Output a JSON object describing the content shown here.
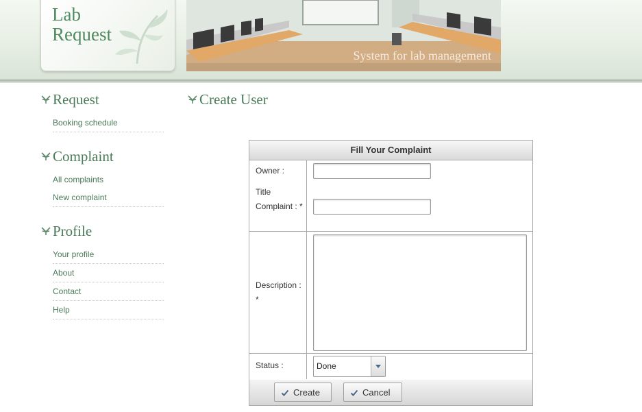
{
  "logo": {
    "line1": "Lab",
    "line2": "Request"
  },
  "banner": {
    "tagline": "System for lab management"
  },
  "sidebar": {
    "sections": [
      {
        "heading": "Request",
        "items": [
          "Booking schedule"
        ]
      },
      {
        "heading": "Complaint",
        "items": [
          "All complaints",
          "New complaint"
        ]
      },
      {
        "heading": "Profile",
        "items": [
          "Your profile",
          "About",
          "Contact",
          "Help"
        ]
      }
    ]
  },
  "page": {
    "title": "Create User"
  },
  "form": {
    "heading": "Fill Your Complaint",
    "owner_label": "Owner :",
    "owner_value": "",
    "title_label": "Title Complaint : *",
    "title_value": "",
    "description_label": "Description : *",
    "description_value": "",
    "status_label": "Status :",
    "status_selected": "Done",
    "create_label": "Create",
    "cancel_label": "Cancel"
  },
  "colors": {
    "accent_green": "#4a7a58",
    "logo_green": "#4f8a5f"
  }
}
